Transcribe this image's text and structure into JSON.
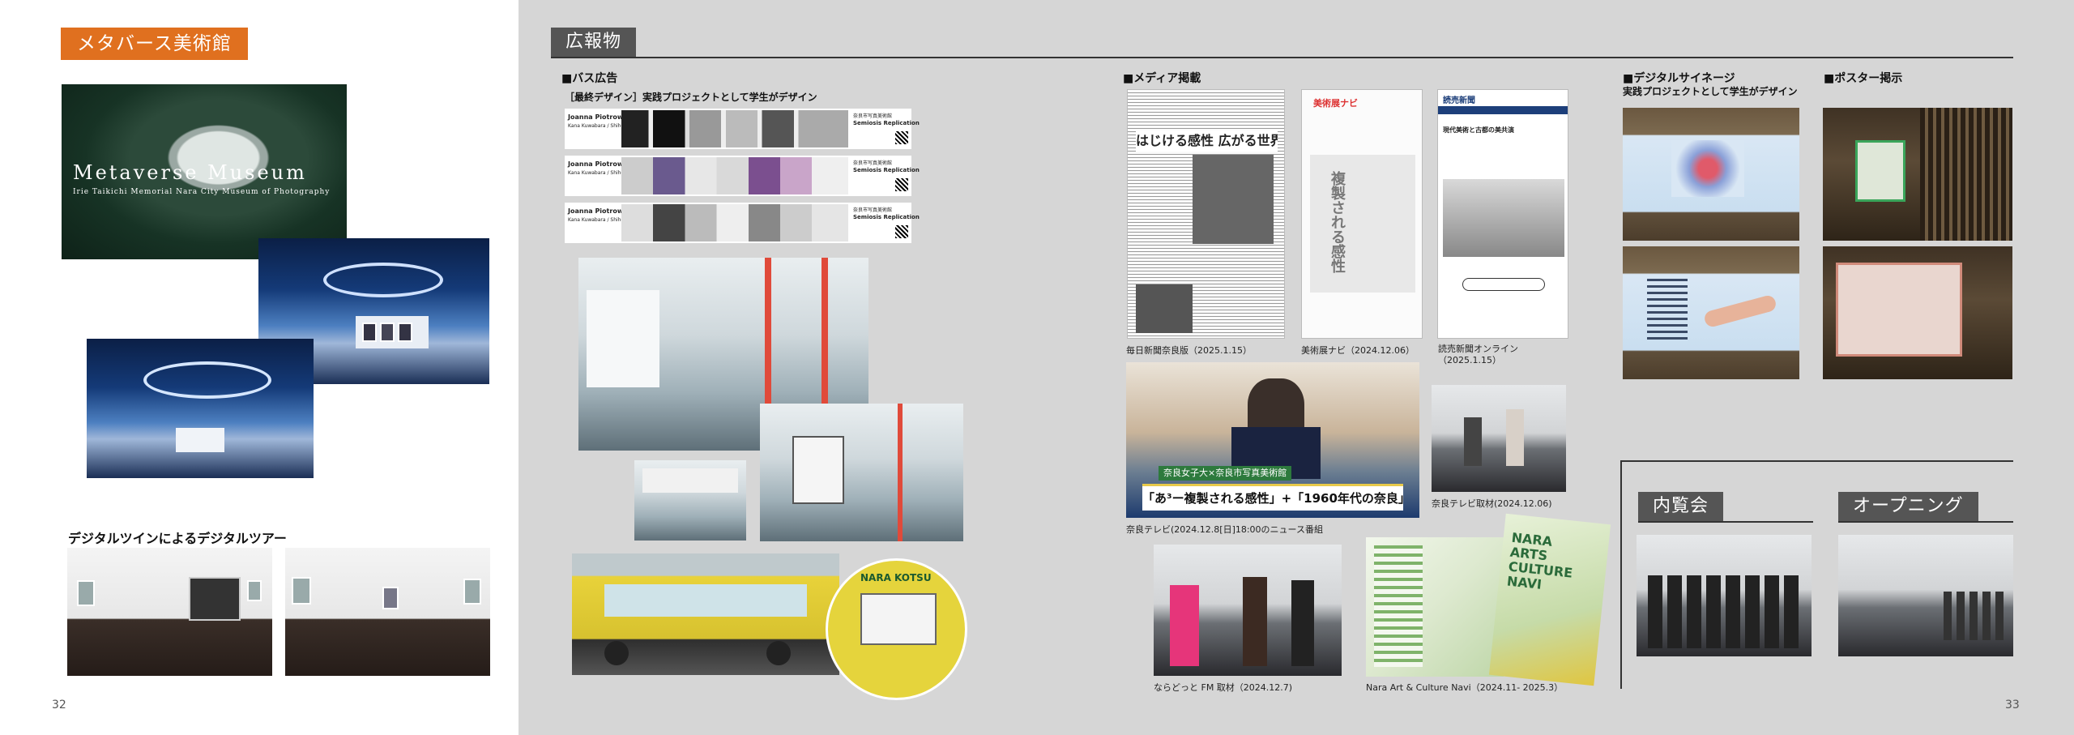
{
  "left": {
    "title": "メタバース美術館",
    "hero_line1": "Metaverse Museum",
    "hero_line2": "Irie Taikichi Memorial Nara City Museum of Photography",
    "tour_heading": "デジタルツインによるデジタルツアー",
    "page_number": "32"
  },
  "right": {
    "title": "広報物",
    "page_number": "33",
    "bus": {
      "heading": "■バス広告",
      "subheading": "［最終デザイン］実践プロジェクトとして学生がデザイン",
      "banner_name": "Joanna Piotrowska",
      "banner_sub": "Kana Kuwabara / Shiho Saito",
      "banner_title": "Semiosis Replication",
      "banner_museum": "奈良市写真美術館",
      "bus_brand": "NARA KOTSU"
    },
    "media": {
      "heading": "■メディア掲載",
      "items": [
        {
          "caption": "毎日新聞奈良版（2025.1.15）",
          "headline": "はじける感性 広がる世界"
        },
        {
          "caption": "美術展ナビ（2024.12.06）",
          "headline": "複製される感性",
          "brand": "美術展ナビ"
        },
        {
          "caption": "読売新聞オンライン\n（2025.1.15）",
          "brand": "読売新聞",
          "headline": "現代美術と古都の美共演"
        }
      ],
      "tv_caption": "奈良テレビ(2024.12.8[日]18:00のニュース番組",
      "tv_tag": "奈良女子大×奈良市写真美術館",
      "tv_ticker": "「あ³ー複製される感性」+「1960年代の奈良」",
      "tv2_caption": "奈良テレビ取材(2024.12.06)",
      "fm_caption": "ならどっと FM 取材（2024.12.7)",
      "navi_caption": "Nara Art & Culture Navi（2024.11- 2025.3）",
      "navi_cover": "NARA ARTS CULTURE NAVI"
    },
    "signage": {
      "heading": "■デジタルサイネージ",
      "subheading": "実践プロジェクトとして学生がデザイン"
    },
    "poster": {
      "heading": "■ポスター掲示"
    },
    "preview": {
      "title": "内覧会"
    },
    "opening": {
      "title": "オープニング"
    }
  },
  "colors": {
    "accent_orange": "#e0701f",
    "right_bg": "#d6d6d6",
    "tag_dark": "#555555"
  }
}
